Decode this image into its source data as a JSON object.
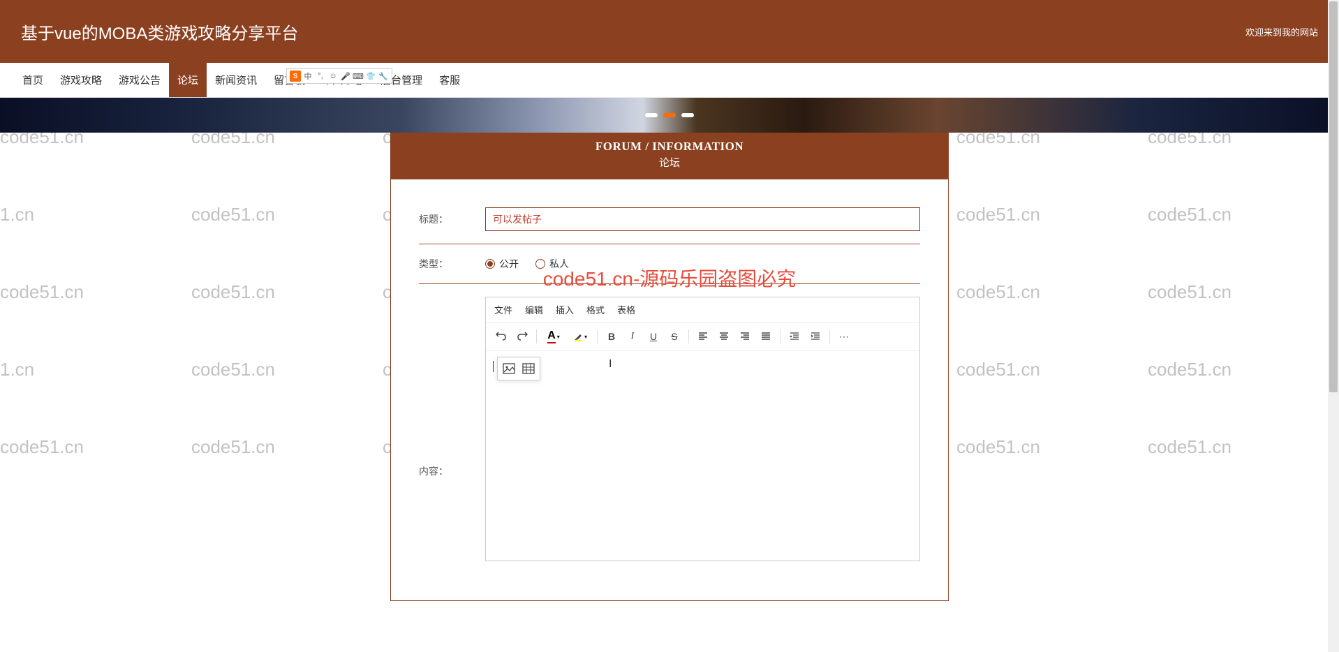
{
  "header": {
    "site_title": "基于vue的MOBA类游戏攻略分享平台",
    "welcome": "欢迎来到我的网站"
  },
  "nav": {
    "items": [
      "首页",
      "游戏攻略",
      "游戏公告",
      "论坛",
      "新闻资讯",
      "留言板",
      "个人中心",
      "后台管理",
      "客服"
    ],
    "active_index": 3
  },
  "section": {
    "title_en": "FORUM / INFORMATION",
    "title_cn": "论坛"
  },
  "form": {
    "title_label": "标题：",
    "title_value": "可以发帖子",
    "type_label": "类型：",
    "type_options": [
      "公开",
      "私人"
    ],
    "type_selected": 0,
    "content_label": "内容："
  },
  "editor": {
    "menus": [
      "文件",
      "编辑",
      "插入",
      "格式",
      "表格"
    ]
  },
  "watermark": "code51.cn",
  "overlay": "code51.cn-源码乐园盗图必究",
  "ime": {
    "label": "中"
  }
}
